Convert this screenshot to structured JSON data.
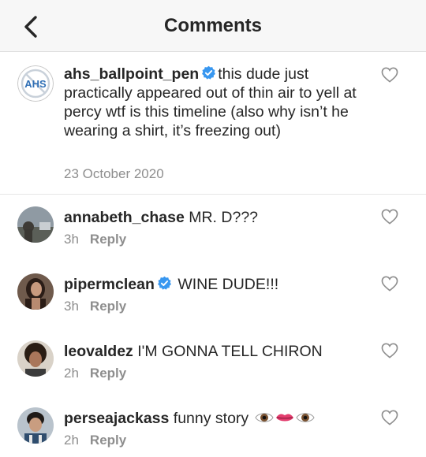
{
  "header": {
    "title": "Comments",
    "back_icon": "chevron-left-icon"
  },
  "caption": {
    "username": "ahs_ballpoint_pen",
    "avatar_text": "AHS",
    "text": "this dude just practically appeared out of thin air to yell at percy wtf is this timeline (also why isn’t he wearing a shirt, it’s freezing out)",
    "date": "23 October 2020"
  },
  "comments": [
    {
      "username": "annabeth_chase",
      "verified": false,
      "text": "MR. D???",
      "time": "3h",
      "reply": "Reply"
    },
    {
      "username": "pipermclean",
      "verified": true,
      "text": "WINE DUDE!!!",
      "time": "3h",
      "reply": "Reply"
    },
    {
      "username": "leovaldez",
      "verified": false,
      "text": "I'M GONNA TELL CHIRON",
      "time": "2h",
      "reply": "Reply"
    },
    {
      "username": "perseajackass",
      "verified": false,
      "text": "funny story",
      "emojis": [
        "eye-emoji",
        "lips-emoji",
        "eye-emoji"
      ],
      "time": "2h",
      "reply": "Reply"
    }
  ],
  "colors": {
    "verified": "#3897f0",
    "secondary_text": "#8e8e8e",
    "heart_outline": "#8e8e8e"
  }
}
